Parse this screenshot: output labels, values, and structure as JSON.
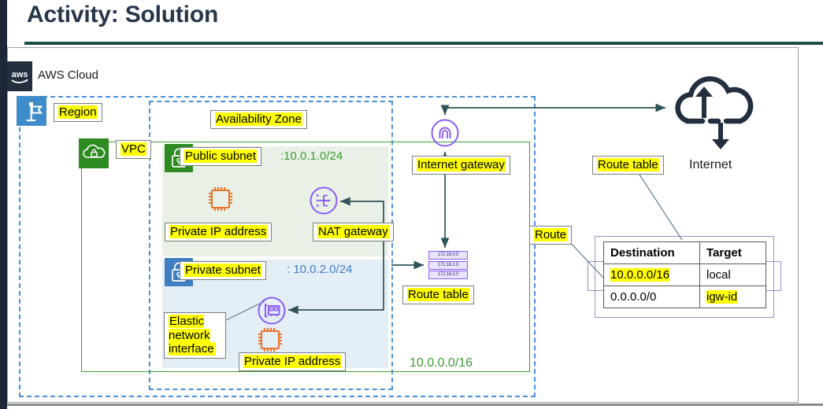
{
  "slide": {
    "title": "Activity: Solution"
  },
  "cloud": {
    "label": "AWS Cloud",
    "logo_icon": "aws-logo-icon"
  },
  "region": {
    "label": "Region",
    "icon": "region-flag-icon"
  },
  "availability_zone": {
    "label": "Availability Zone"
  },
  "vpc": {
    "label": "VPC",
    "icon": "vpc-cloud-lock-icon",
    "cidr": "10.0.0.0/16"
  },
  "public_subnet": {
    "label": "Public subnet",
    "cidr": ":10.0.1.0/24",
    "icon": "subnet-lock-icon",
    "resources": [
      {
        "name": "private-ip-address",
        "label": "Private IP address",
        "icon": "ec2-instance-icon"
      },
      {
        "name": "nat-gateway",
        "label": "NAT gateway",
        "icon": "nat-gateway-icon"
      }
    ]
  },
  "private_subnet": {
    "label": "Private subnet",
    "cidr": ": 10.0.2.0/24",
    "icon": "subnet-lock-icon",
    "resources": [
      {
        "name": "elastic-network-interface",
        "label": "Elastic network interface",
        "icon": "eni-icon"
      },
      {
        "name": "private-ip-address",
        "label": "Private IP address",
        "icon": "ec2-instance-icon"
      }
    ]
  },
  "internet_gateway": {
    "label": "Internet gateway",
    "icon": "internet-gateway-icon"
  },
  "vpc_route_table": {
    "label": "Route table",
    "icon": "route-table-icon",
    "rows": [
      "172.16.0.0",
      "172.16.1.0",
      "172.16.2.0"
    ]
  },
  "internet": {
    "label": "Internet",
    "icon": "internet-cloud-icon"
  },
  "route_table_panel": {
    "title_callout": "Route table",
    "route_callout": "Route",
    "headers": [
      "Destination",
      "Target"
    ],
    "rows": [
      {
        "destination": "10.0.0.0/16",
        "target": "local",
        "destination_highlighted": true,
        "target_highlighted": false
      },
      {
        "destination": "0.0.0.0/0",
        "target": "igw-id",
        "destination_highlighted": false,
        "target_highlighted": true
      }
    ]
  },
  "colors": {
    "title": "#27364b",
    "title_rule": "#1f4e4a",
    "aws_navy": "#232f3e",
    "region_blue": "#4a90d9",
    "vpc_green": "#3f9c35",
    "subnet_green_fill": "#e9f0e6",
    "subnet_blue_fill": "#e4eef6",
    "private_subnet_blue": "#3f7fc1",
    "purple_icon": "#8b5cf6",
    "orange_icon": "#e8762d",
    "connector": "#2f5357",
    "highlight": "#ffff00"
  }
}
